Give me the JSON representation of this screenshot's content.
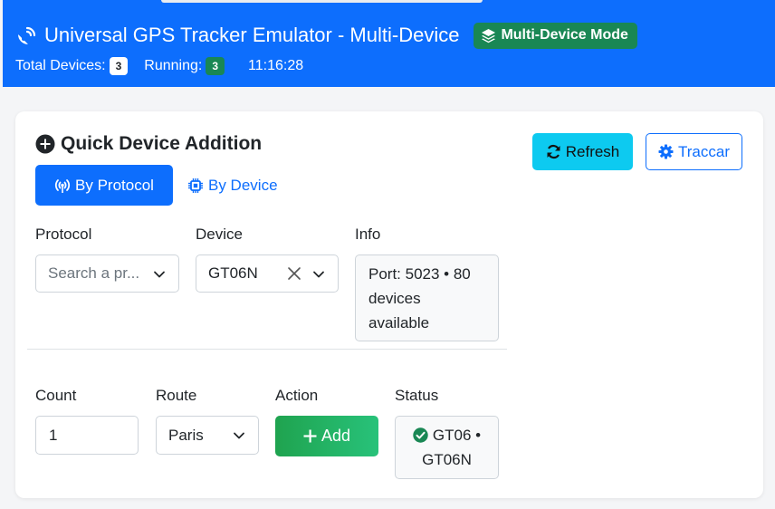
{
  "header": {
    "title": "Universal GPS Tracker Emulator - Multi-Device",
    "mode_badge": "Multi-Device Mode",
    "total_devices_label": "Total Devices:",
    "total_devices": "3",
    "running_label": "Running:",
    "running": "3",
    "clock": "11:16:28"
  },
  "card": {
    "title": "Quick Device Addition",
    "refresh_label": "Refresh",
    "traccar_label": "Traccar",
    "tabs": [
      {
        "label": "By Protocol",
        "active": true
      },
      {
        "label": "By Device",
        "active": false
      }
    ],
    "protocol": {
      "label": "Protocol",
      "placeholder": "Search a pr..."
    },
    "device": {
      "label": "Device",
      "value": "GT06N"
    },
    "info": {
      "label": "Info",
      "text": "Port: 5023 • 80 devices available"
    },
    "count": {
      "label": "Count",
      "value": "1"
    },
    "route": {
      "label": "Route",
      "value": "Paris"
    },
    "action": {
      "label": "Action",
      "add_label": "Add"
    },
    "status": {
      "label": "Status",
      "line1": "GT06 •",
      "line2": "GT06N"
    }
  },
  "icons": {
    "title": "satellite-dish-icon",
    "badge": "layers-icon",
    "section": "plus-circle-icon",
    "refresh": "sync-icon",
    "traccar": "gear-icon",
    "protocol_tab": "broadcast-tower-icon",
    "device_tab": "chip-icon",
    "status": "check-circle-icon"
  },
  "colors": {
    "primary": "#0d6efd",
    "success": "#198754",
    "info": "#0dcaf0"
  }
}
